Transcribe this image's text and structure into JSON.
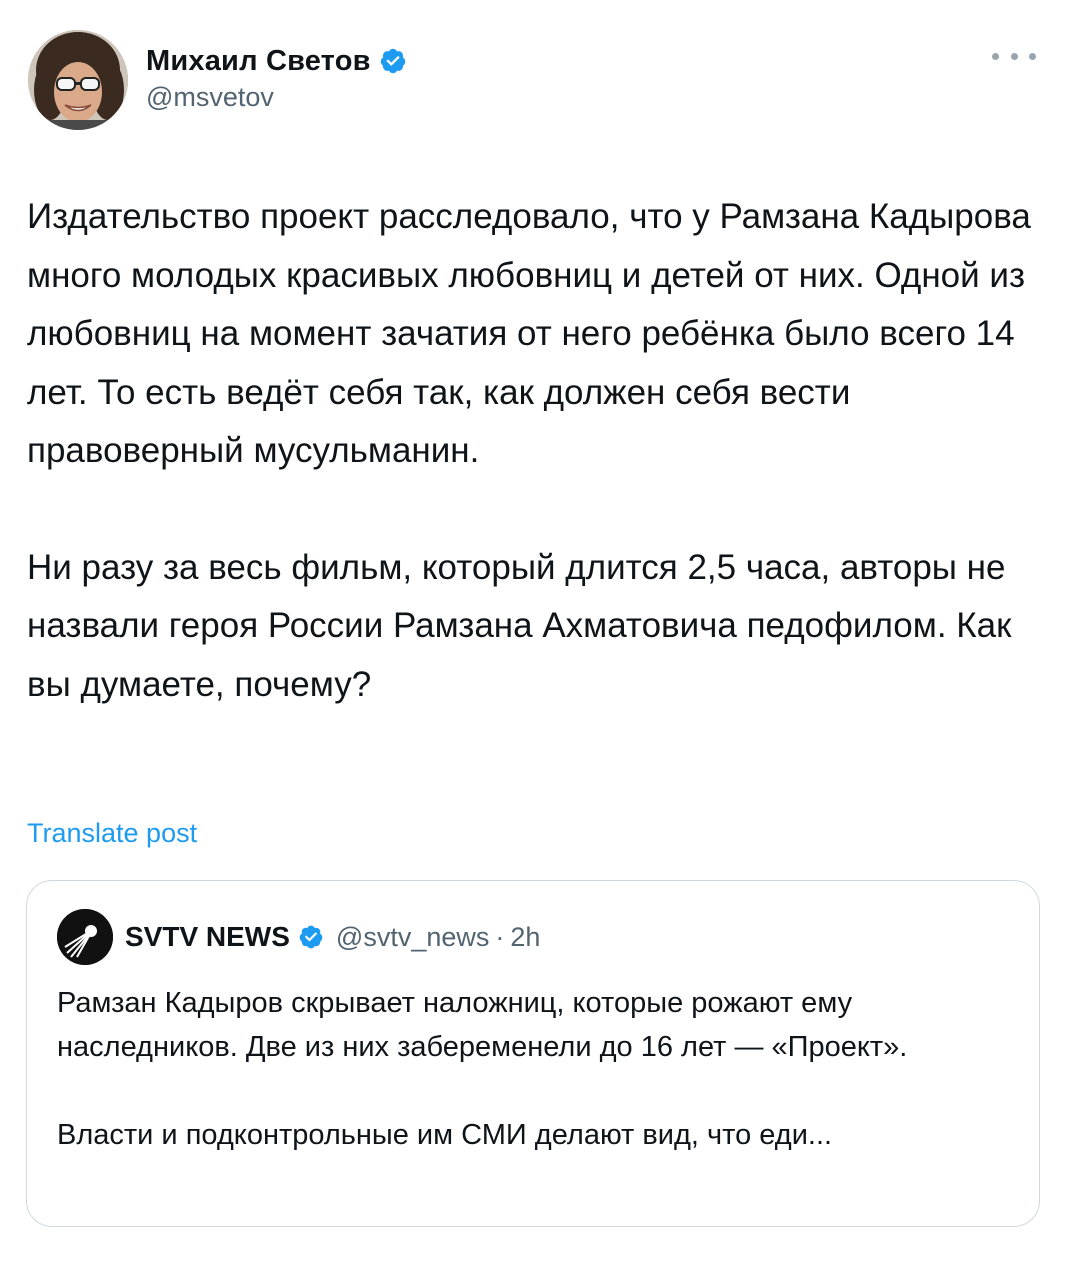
{
  "author": {
    "display_name": "Михаил Светов",
    "handle": "@msvetov",
    "verified": true
  },
  "more_icon": "more-horizontal-icon",
  "tweet": {
    "paragraphs": [
      "Издательство проект расследовало, что у Рамзана Кадырова много молодых красивых любовниц и детей от них. Одной из любовниц на момент зачатия от него ребёнка было всего 14 лет. То есть ведёт себя так, как должен себя вести правоверный мусульманин.",
      "Ни разу за весь фильм, который длится 2,5 часа, авторы не назвали героя России Рамзана Ахматовича педофилом. Как вы думаете, почему?"
    ],
    "translate_label": "Translate post"
  },
  "quoted": {
    "display_name": "SVTV NEWS",
    "handle": "@svtv_news",
    "separator": "·",
    "time": "2h",
    "verified": true,
    "paragraphs": [
      "Рамзан Кадыров скрывает наложниц, которые рожают ему наследников. Две из них забеременели до 16 лет — «Проект».",
      "Власти и подконтрольные им СМИ делают вид, что еди..."
    ]
  },
  "colors": {
    "accent": "#1d9bf0",
    "text": "#0f1419",
    "secondary_text": "#536471",
    "border": "#cfd9de"
  }
}
